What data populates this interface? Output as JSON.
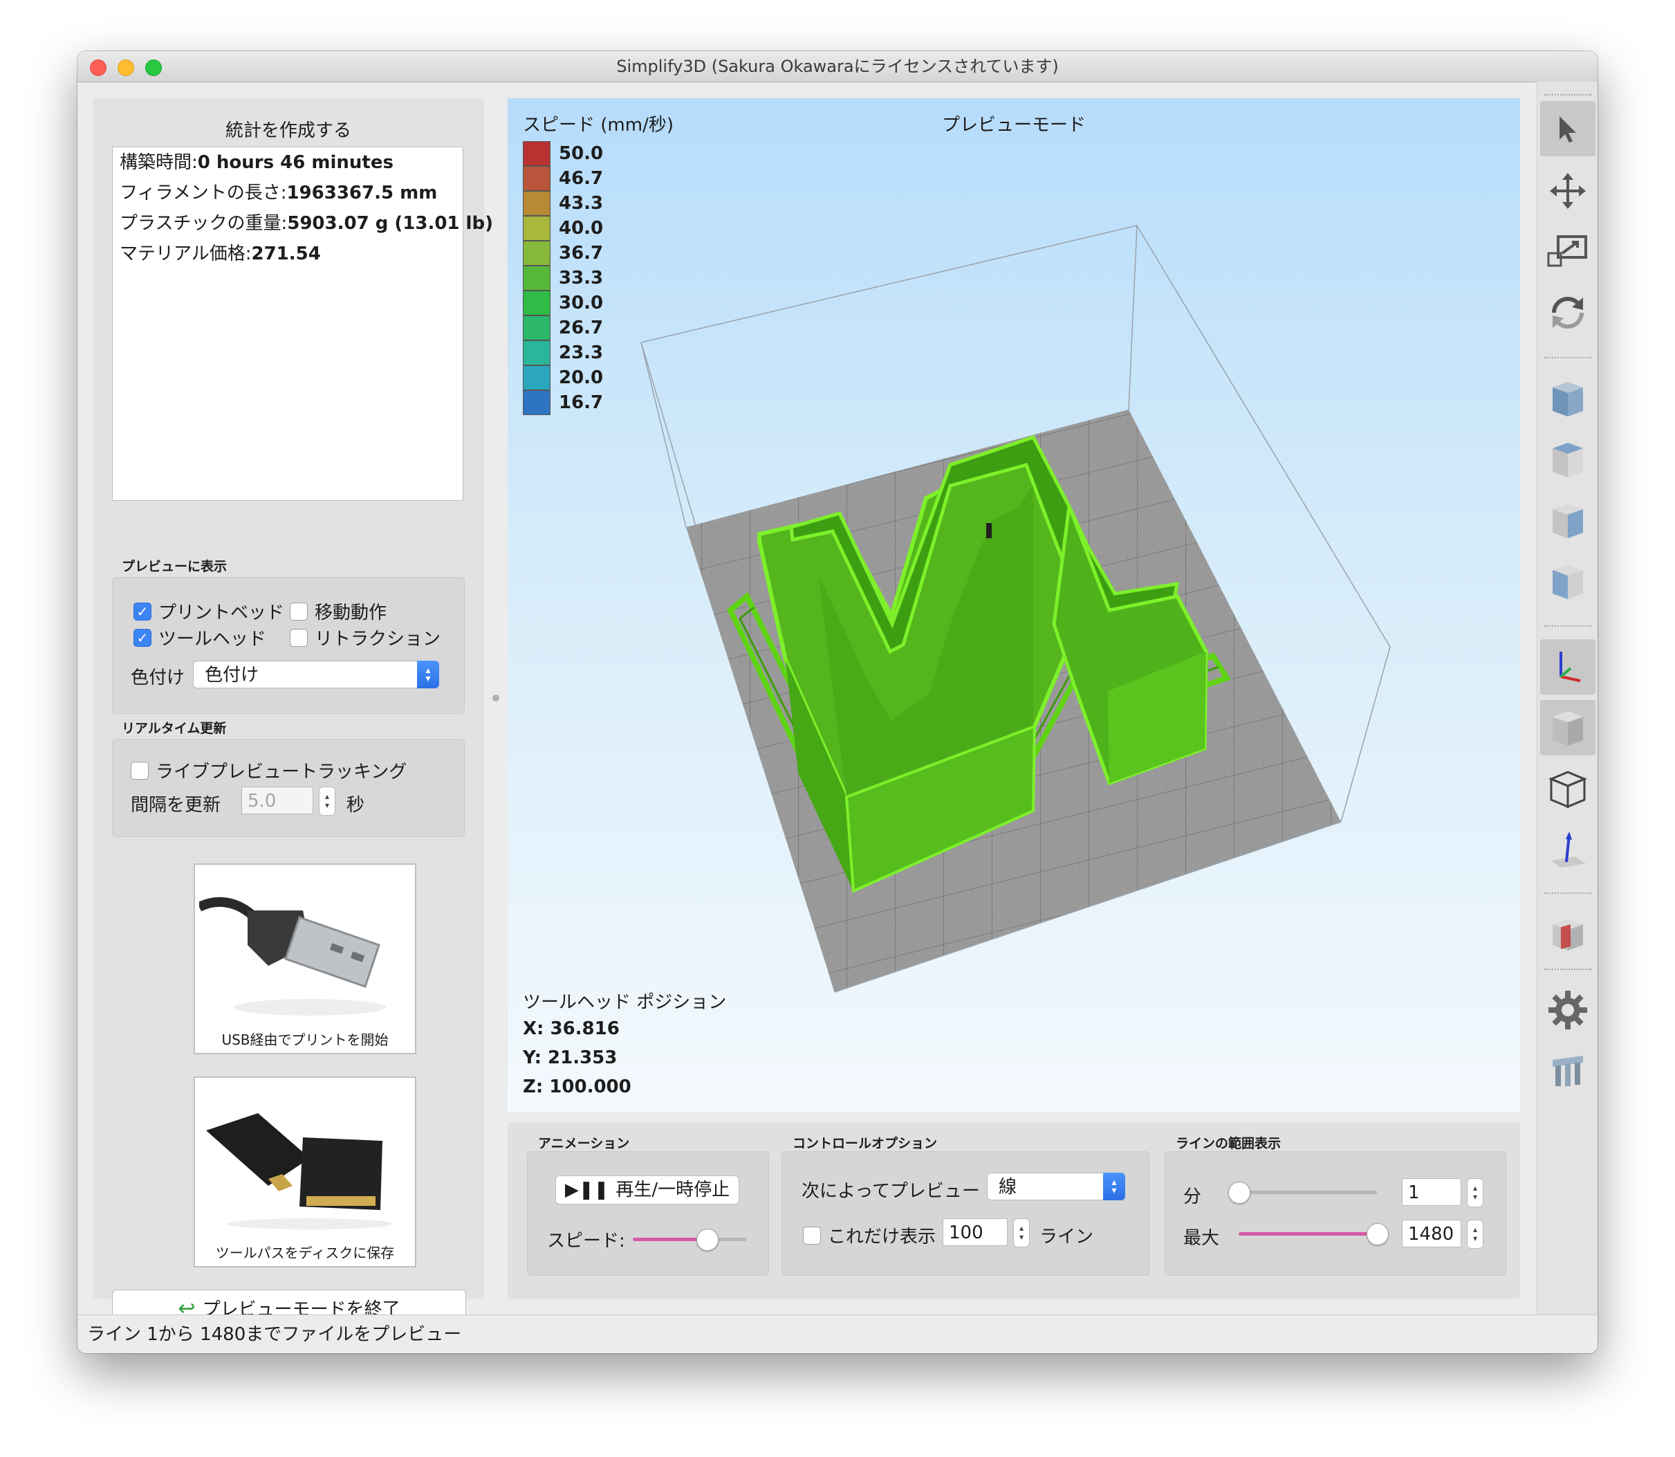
{
  "window": {
    "title": "Simplify3D (Sakura Okawaraにライセンスされています)"
  },
  "stats": {
    "heading": "統計を作成する",
    "rows": [
      {
        "label": "構築時間:",
        "value": "0 hours 46 minutes"
      },
      {
        "label": "フィラメントの長さ:",
        "value": "1963367.5 mm"
      },
      {
        "label": "プラスチックの重量:",
        "value": "5903.07 g (13.01 lb)"
      },
      {
        "label": "マテリアル価格:",
        "value": "271.54"
      }
    ]
  },
  "preview_display": {
    "label": "プレビューに表示",
    "print_bed": {
      "label": "プリントベッド",
      "checked": true
    },
    "travel": {
      "label": "移動動作",
      "checked": false
    },
    "tool_head": {
      "label": "ツールヘッド",
      "checked": true
    },
    "retraction": {
      "label": "リトラクション",
      "checked": false
    },
    "coloring_label": "色付け",
    "coloring_value": "色付け"
  },
  "realtime": {
    "label": "リアルタイム更新",
    "live_tracking": {
      "label": "ライブプレビュートラッキング",
      "checked": false
    },
    "interval_label": "間隔を更新",
    "interval_value": "5.0",
    "interval_unit": "秒"
  },
  "usb_button": {
    "caption": "USB経由でプリントを開始"
  },
  "disk_button": {
    "caption": "ツールパスをディスクに保存"
  },
  "exit_button": {
    "label": "プレビューモードを終了"
  },
  "viewport": {
    "mode_title": "プレビューモード",
    "legend_title": "スピード (mm/秒)",
    "legend": [
      {
        "value": "50.0",
        "color": "#b83232"
      },
      {
        "value": "46.7",
        "color": "#b8553a"
      },
      {
        "value": "43.3",
        "color": "#b88a36"
      },
      {
        "value": "40.0",
        "color": "#a9b83a"
      },
      {
        "value": "36.7",
        "color": "#86b83a"
      },
      {
        "value": "33.3",
        "color": "#55b83a"
      },
      {
        "value": "30.0",
        "color": "#2fbb45"
      },
      {
        "value": "26.7",
        "color": "#2bb86a"
      },
      {
        "value": "23.3",
        "color": "#2ab69a"
      },
      {
        "value": "20.0",
        "color": "#2ba6bd"
      },
      {
        "value": "16.7",
        "color": "#2f74c0"
      }
    ],
    "toolhead_label": "ツールヘッド ポジション",
    "x": "X: 36.816",
    "y": "Y: 21.353",
    "z": "Z: 100.000"
  },
  "animation": {
    "label": "アニメーション",
    "play_label": "再生/一時停止",
    "speed_label": "スピード:",
    "speed_fraction": 0.65
  },
  "control_options": {
    "label": "コントロールオプション",
    "preview_by_label": "次によってプレビュー",
    "preview_by_value": "線",
    "only_show": {
      "label": "これだけ表示",
      "checked": false
    },
    "only_show_value": "100",
    "only_show_unit": "ライン"
  },
  "line_range": {
    "label": "ラインの範囲表示",
    "min_label": "分",
    "min_value": "1",
    "min_fraction": 0.0,
    "max_label": "最大",
    "max_value": "1480",
    "max_fraction": 1.0
  },
  "status_bar": {
    "text": "ライン 1から 1480までファイルをプレビュー"
  },
  "toolbar": {
    "icons": [
      "select-arrow-icon",
      "move-icon",
      "scale-icon",
      "rotate-icon",
      "cube-view-icon",
      "cube-top-icon",
      "cube-side-icon",
      "cube-front-icon",
      "axes-icon",
      "solid-cube-icon",
      "wireframe-cube-icon",
      "z-axis-icon",
      "cross-section-icon",
      "gear-icon",
      "dual-extruder-icon"
    ]
  }
}
